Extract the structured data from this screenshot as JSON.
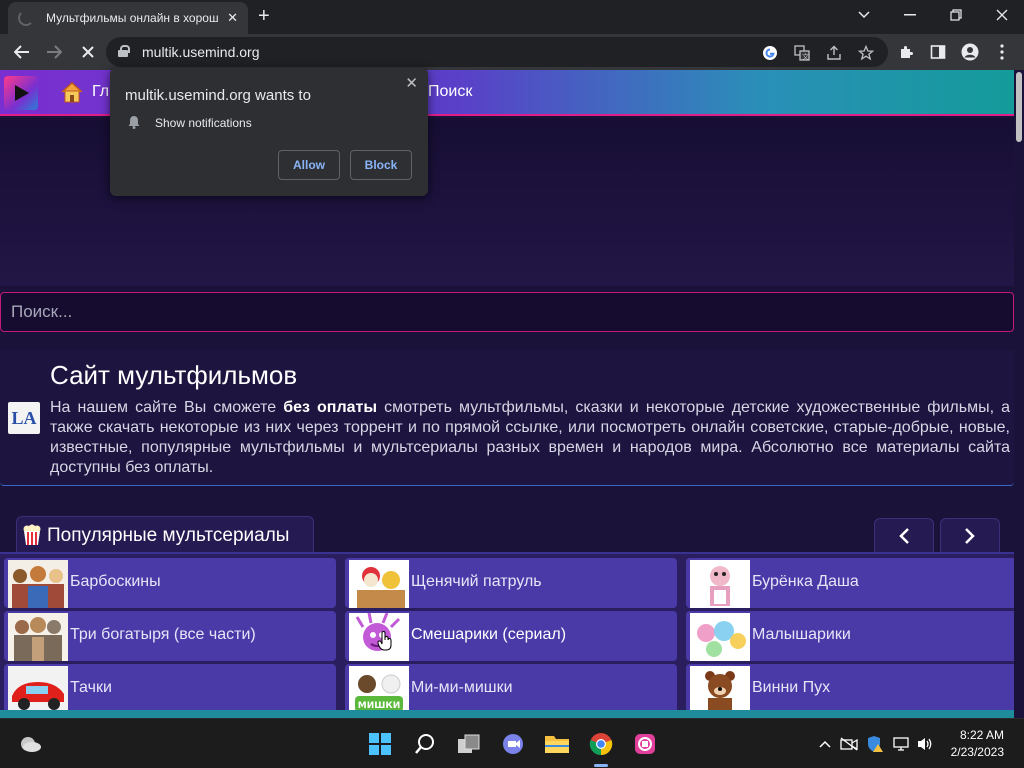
{
  "browser": {
    "tab_title": "Мультфильмы онлайн в хорош",
    "tab_close": "✕",
    "new_tab": "+",
    "url": "multik.usemind.org"
  },
  "permission_popup": {
    "title": "multik.usemind.org wants to",
    "permission": "Show notifications",
    "allow_label": "Allow",
    "block_label": "Block",
    "close": "✕"
  },
  "site": {
    "nav": {
      "home_label": "Гл",
      "search_label": "Поиск"
    },
    "search": {
      "placeholder": "Поиск..."
    },
    "about": {
      "logo_text": "LA",
      "title": "Сайт мультфильмов",
      "text_before": "На нашем сайте Вы сможете ",
      "text_bold": "без оплаты",
      "text_after": " смотреть мультфильмы, сказки и некоторые детские художественные фильмы, а также скачать некоторые из них через торрент и по прямой ссылке, или посмотреть онлайн советские, старые-добрые, новые, известные, популярные мультфильмы и мультсериалы разных времен и народов мира. Абсолютно все материалы сайта доступны без оплаты."
    },
    "popular": {
      "title": "Популярные мультсериалы",
      "prev": "‹",
      "next": "›",
      "items": [
        {
          "label": "Барбоскины"
        },
        {
          "label": "Щенячий патруль"
        },
        {
          "label": "Бурёнка Даша"
        },
        {
          "label": "Три богатыря (все части)"
        },
        {
          "label": "Смешарики (сериал)"
        },
        {
          "label": "Малышарики"
        },
        {
          "label": "Тачки"
        },
        {
          "label": "Ми-ми-мишки"
        },
        {
          "label": "Винни Пух"
        }
      ]
    }
  },
  "taskbar": {
    "time": "8:22 AM",
    "date": "2/23/2023"
  },
  "colors": {
    "page_bg": "#1a1238",
    "accent_pink": "#e01e8a",
    "card_bg": "#4a3aa8",
    "chrome_dark": "#202124",
    "chrome_toolbar": "#35363a",
    "link_blue": "#8ab4f8"
  }
}
